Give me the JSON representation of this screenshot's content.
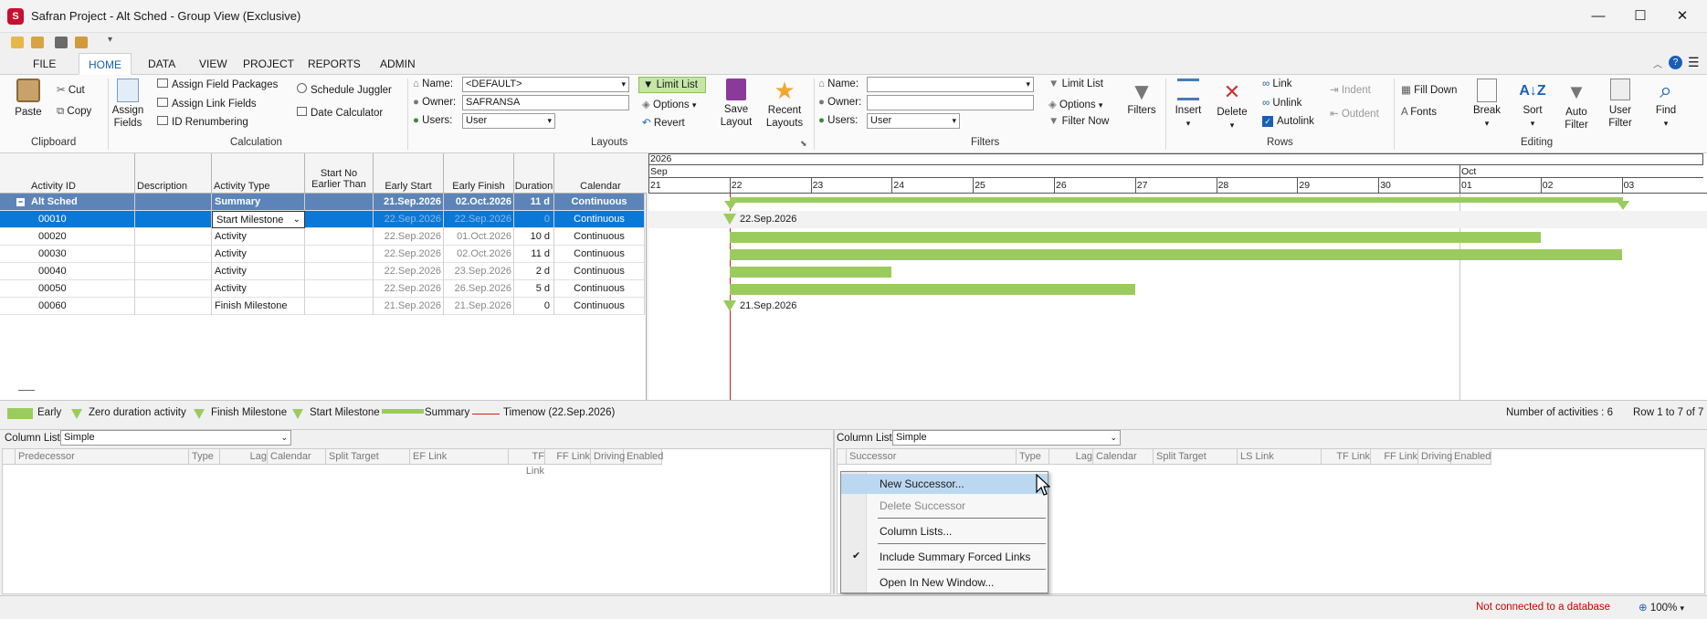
{
  "window": {
    "title": "Safran Project - Alt Sched - Group View (Exclusive)",
    "minimize": "—",
    "maximize": "☐",
    "close": "✕"
  },
  "tabs": [
    "FILE",
    "HOME",
    "DATA",
    "VIEW",
    "PROJECT",
    "REPORTS",
    "ADMIN"
  ],
  "clipboard": {
    "paste": "Paste",
    "cut": "Cut",
    "copy": "Copy",
    "group": "Clipboard"
  },
  "calculation": {
    "assign_fields": "Assign Fields",
    "assign_field_packages": "Assign Field Packages",
    "assign_link_fields": "Assign Link Fields",
    "id_renumbering": "ID Renumbering",
    "schedule_juggler": "Schedule Juggler",
    "date_calculator": "Date Calculator",
    "group": "Calculation"
  },
  "layouts": {
    "name_label": "Name:",
    "name_value": "<DEFAULT>",
    "owner_label": "Owner:",
    "owner_value": "SAFRANSA",
    "users_label": "Users:",
    "users_value": "User",
    "limit_list": "Limit List",
    "options": "Options",
    "revert": "Revert",
    "save_layout": "Save Layout",
    "recent_layouts": "Recent Layouts",
    "group": "Layouts"
  },
  "filters": {
    "name_label": "Name:",
    "name_value": "",
    "owner_label": "Owner:",
    "owner_value": "",
    "users_label": "Users:",
    "users_value": "User",
    "limit_list": "Limit List",
    "options": "Options",
    "filter_now": "Filter Now",
    "filters": "Filters",
    "group": "Filters"
  },
  "rows_group": {
    "insert": "Insert",
    "delete": "Delete",
    "link": "Link",
    "unlink": "Unlink",
    "autolink": "Autolink",
    "indent": "Indent",
    "outdent": "Outdent",
    "group": "Rows"
  },
  "editing": {
    "fill_down": "Fill Down",
    "fonts": "Fonts",
    "break": "Break",
    "sort": "Sort",
    "auto_filter": "Auto Filter",
    "user_filter": "User Filter",
    "find": "Find",
    "group": "Editing"
  },
  "grid": {
    "headers": [
      "Activity ID",
      "Description",
      "Activity Type",
      "Start No Earlier Than",
      "Early Start",
      "Early Finish",
      "Duration",
      "Calendar"
    ],
    "summary": {
      "id": "Alt Sched",
      "desc": "",
      "type": "Summary",
      "snet": "",
      "es": "21.Sep.2026",
      "ef": "02.Oct.2026",
      "dur": "11 d",
      "cal": "Continuous"
    },
    "rows": [
      {
        "id": "00010",
        "type": "Start Milestone",
        "es": "22.Sep.2026",
        "ef": "22.Sep.2026",
        "dur": "0",
        "cal": "Continuous"
      },
      {
        "id": "00020",
        "type": "Activity",
        "es": "22.Sep.2026",
        "ef": "01.Oct.2026",
        "dur": "10 d",
        "cal": "Continuous"
      },
      {
        "id": "00030",
        "type": "Activity",
        "es": "22.Sep.2026",
        "ef": "02.Oct.2026",
        "dur": "11 d",
        "cal": "Continuous"
      },
      {
        "id": "00040",
        "type": "Activity",
        "es": "22.Sep.2026",
        "ef": "23.Sep.2026",
        "dur": "2 d",
        "cal": "Continuous"
      },
      {
        "id": "00050",
        "type": "Activity",
        "es": "22.Sep.2026",
        "ef": "26.Sep.2026",
        "dur": "5 d",
        "cal": "Continuous"
      },
      {
        "id": "00060",
        "type": "Finish Milestone",
        "es": "21.Sep.2026",
        "ef": "21.Sep.2026",
        "dur": "0",
        "cal": "Continuous"
      }
    ]
  },
  "gantt": {
    "year": "2026",
    "month1": "Sep",
    "month2": "Oct",
    "days": [
      "21",
      "22",
      "23",
      "24",
      "25",
      "26",
      "27",
      "28",
      "29",
      "30",
      "01",
      "02",
      "03"
    ],
    "label_00010": "22.Sep.2026",
    "label_00060": "21.Sep.2026"
  },
  "legend": {
    "early": "Early",
    "zero": "Zero duration activity",
    "finish": "Finish Milestone",
    "start": "Start Milestone",
    "summary": "Summary",
    "timenow": "Timenow (22.Sep.2026)",
    "count": "Number of activities : 6",
    "rows": "Row 1 to 7 of 7"
  },
  "pred_panel": {
    "column_list_label": "Column List:",
    "column_list_value": "Simple",
    "headers": [
      "Predecessor",
      "Type",
      "Lag",
      "Calendar",
      "Split Target",
      "EF Link",
      "TF Link",
      "FF Link",
      "Driving",
      "Enabled"
    ]
  },
  "succ_panel": {
    "column_list_label": "Column List:",
    "column_list_value": "Simple",
    "headers": [
      "Successor",
      "Type",
      "Lag",
      "Calendar",
      "Split Target",
      "LS Link",
      "TF Link",
      "FF Link",
      "Driving",
      "Enabled"
    ]
  },
  "context_menu": {
    "new_successor": "New Successor...",
    "delete_successor": "Delete Successor",
    "column_lists": "Column Lists...",
    "include_summary": "Include Summary Forced Links",
    "open_new_window": "Open In New Window...",
    "check": "✔"
  },
  "status": {
    "connection": "Not connected to a database",
    "zoom": "100%"
  },
  "colors": {
    "bar": "#9ccb5d",
    "selected_row": "#0a78d7",
    "timenow": "#d02020",
    "status_error": "#d00000"
  }
}
